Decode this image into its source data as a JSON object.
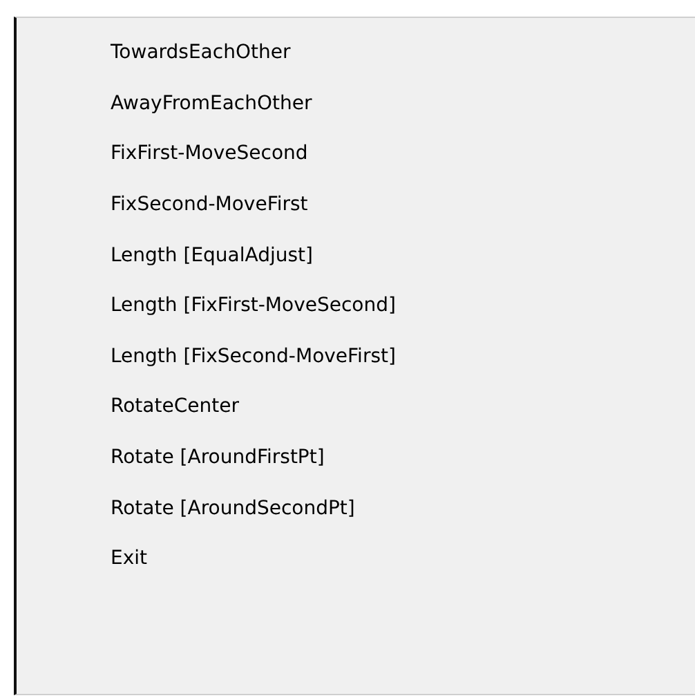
{
  "menu": {
    "items": [
      {
        "label": "TowardsEachOther"
      },
      {
        "label": "AwayFromEachOther"
      },
      {
        "label": "FixFirst-MoveSecond"
      },
      {
        "label": "FixSecond-MoveFirst"
      },
      {
        "label": "Length [EqualAdjust]"
      },
      {
        "label": "Length [FixFirst-MoveSecond]"
      },
      {
        "label": "Length [FixSecond-MoveFirst]"
      },
      {
        "label": "RotateCenter"
      },
      {
        "label": "Rotate [AroundFirstPt]"
      },
      {
        "label": "Rotate [AroundSecondPt]"
      },
      {
        "label": "Exit"
      }
    ]
  }
}
